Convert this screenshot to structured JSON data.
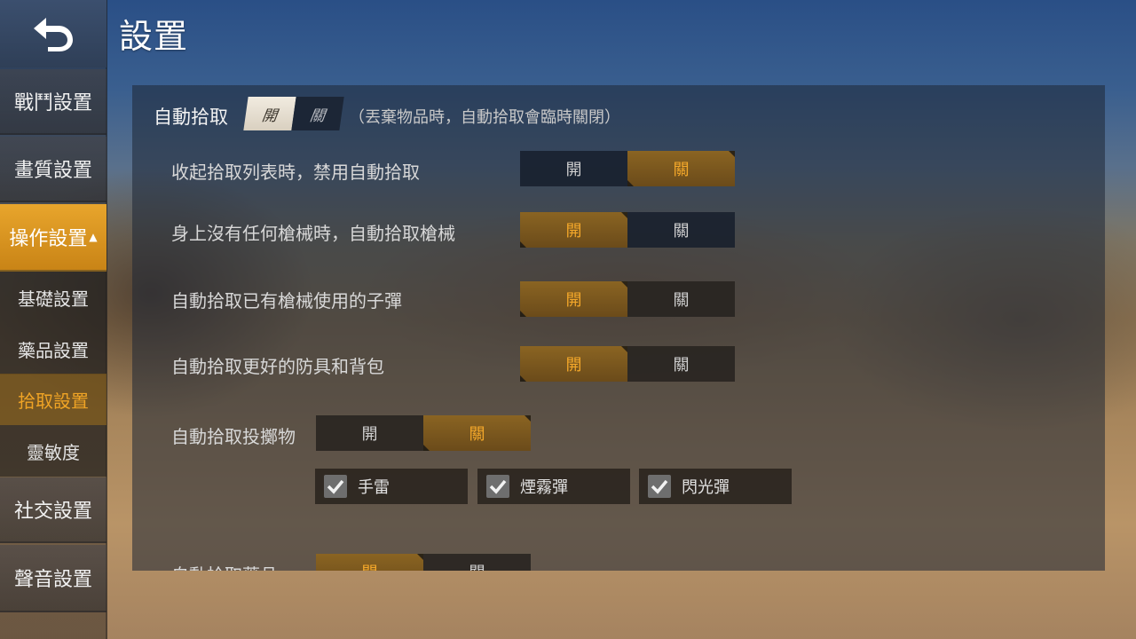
{
  "header": {
    "title": "設置"
  },
  "sidebar": {
    "items": [
      {
        "label": "戰鬥設置"
      },
      {
        "label": "畫質設置"
      },
      {
        "label": "操作設置",
        "caret": "▲"
      },
      {
        "label": "社交設置"
      },
      {
        "label": "聲音設置"
      }
    ],
    "sub_items": [
      {
        "label": "基礎設置"
      },
      {
        "label": "藥品設置"
      },
      {
        "label": "拾取設置"
      },
      {
        "label": "靈敏度"
      }
    ]
  },
  "auto_pickup": {
    "label": "自動拾取",
    "on": "開",
    "off": "關",
    "hint": "（丟棄物品時，自動拾取會臨時關閉）",
    "selected": "on"
  },
  "settings": [
    {
      "label": "收起拾取列表時，禁用自動拾取",
      "on": "開",
      "off": "關",
      "selected": "off"
    },
    {
      "label": "身上沒有任何槍械時，自動拾取槍械",
      "on": "開",
      "off": "關",
      "selected": "on"
    },
    {
      "label": "自動拾取已有槍械使用的子彈",
      "on": "開",
      "off": "關",
      "selected": "on"
    },
    {
      "label": "自動拾取更好的防具和背包",
      "on": "開",
      "off": "關",
      "selected": "on"
    },
    {
      "label": "自動拾取投擲物",
      "on": "開",
      "off": "關",
      "selected": "off"
    },
    {
      "label": "自動拾取藥品",
      "on": "開",
      "off": "關",
      "selected": "on"
    }
  ],
  "throwables": [
    {
      "label": "手雷",
      "checked": true
    },
    {
      "label": "煙霧彈",
      "checked": true
    },
    {
      "label": "閃光彈",
      "checked": true
    }
  ],
  "colors": {
    "accent": "#f0a425",
    "selected_segment": "#7a581f"
  }
}
